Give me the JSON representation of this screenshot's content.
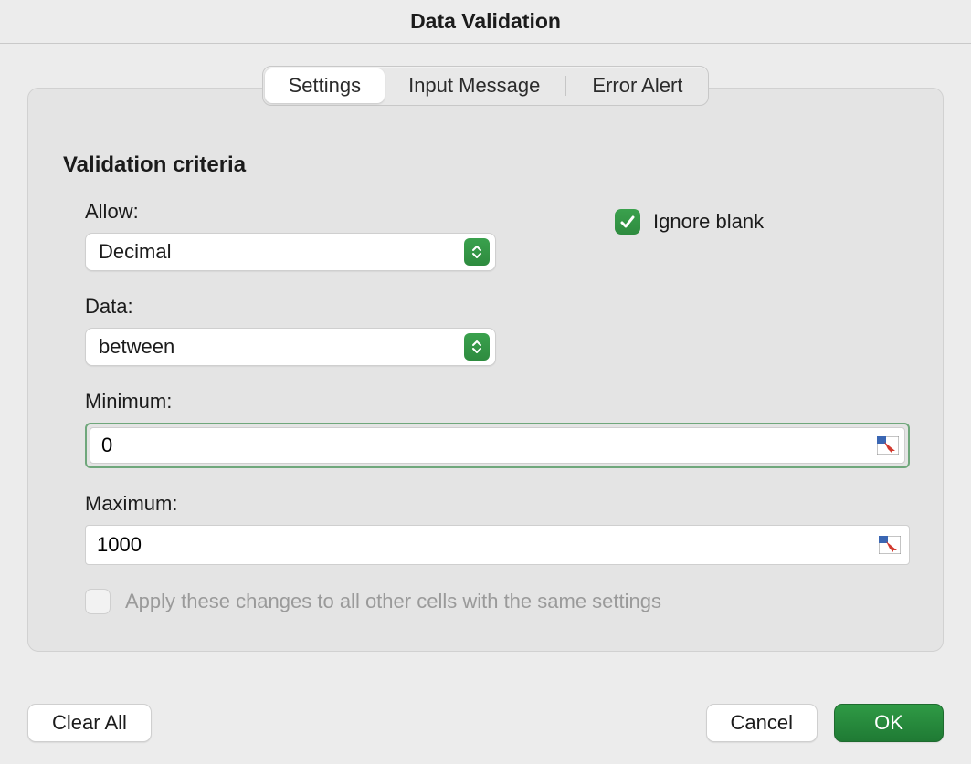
{
  "dialog": {
    "title": "Data Validation"
  },
  "tabs": {
    "settings": "Settings",
    "input_message": "Input Message",
    "error_alert": "Error Alert",
    "active": "settings"
  },
  "criteria": {
    "heading": "Validation criteria",
    "allow_label": "Allow:",
    "allow_value": "Decimal",
    "ignore_blank_label": "Ignore blank",
    "ignore_blank_checked": true,
    "data_label": "Data:",
    "data_value": "between",
    "minimum_label": "Minimum:",
    "minimum_value": "0",
    "maximum_label": "Maximum:",
    "maximum_value": "1000",
    "apply_all_label": "Apply these changes to all other cells with the same settings",
    "apply_all_checked": false,
    "apply_all_enabled": false
  },
  "buttons": {
    "clear_all": "Clear All",
    "cancel": "Cancel",
    "ok": "OK"
  },
  "colors": {
    "accent_green": "#2e8b3f"
  }
}
